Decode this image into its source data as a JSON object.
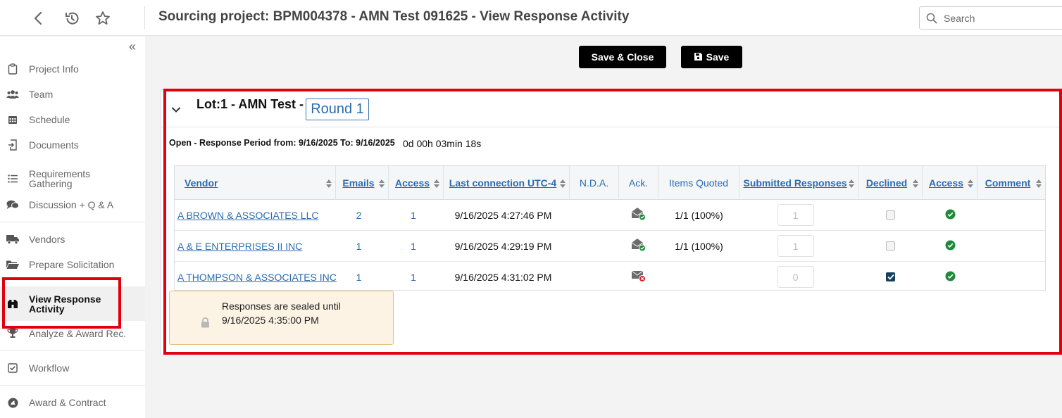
{
  "header": {
    "title": "Sourcing project: BPM004378 - AMN Test 091625 - View Response Activity",
    "search_placeholder": "Search"
  },
  "sidebar": {
    "items": [
      {
        "label": "Project Info",
        "icon": "clipboard-icon"
      },
      {
        "label": "Team",
        "icon": "team-icon"
      },
      {
        "label": "Schedule",
        "icon": "calendar-icon"
      },
      {
        "label": "Documents",
        "icon": "document-icon"
      },
      {
        "label": "Requirements Gathering",
        "icon": "list-icon"
      },
      {
        "label": "Discussion + Q & A",
        "icon": "chat-icon"
      },
      {
        "label": "Vendors",
        "icon": "truck-icon"
      },
      {
        "label": "Prepare Solicitation",
        "icon": "folder-icon"
      },
      {
        "label": "View Response Activity",
        "icon": "binoculars-icon",
        "active": true
      },
      {
        "label": "Analyze & Award Rec.",
        "icon": "trophy-icon"
      },
      {
        "label": "Workflow",
        "icon": "checkbox-icon"
      },
      {
        "label": "Award & Contract",
        "icon": "award-icon"
      }
    ]
  },
  "toolbar": {
    "save_close_label": "Save & Close",
    "save_label": "Save"
  },
  "lot": {
    "title": "Lot:1 - AMN Test -",
    "round": "Round 1",
    "period": "Open - Response Period from: 9/16/2025 To: 9/16/2025",
    "countdown": "0d 00h 03min 18s"
  },
  "table": {
    "columns": [
      "Vendor",
      "Emails",
      "Access",
      "Last connection UTC-4",
      "N.D.A.",
      "Ack.",
      "Items Quoted",
      "Submitted Responses",
      "Declined",
      "Access",
      "Comment"
    ],
    "rows": [
      {
        "vendor": "A BROWN & ASSOCIATES LLC",
        "emails": "2",
        "access": "1",
        "last_connection": "9/16/2025 4:27:46 PM",
        "nda": "",
        "ack": "acknowledged-icon",
        "items_quoted": "1/1 (100%)",
        "submitted": "1",
        "declined": false,
        "access_status": "check-icon",
        "comment": ""
      },
      {
        "vendor": "A & E ENTERPRISES II INC",
        "emails": "1",
        "access": "1",
        "last_connection": "9/16/2025 4:29:19 PM",
        "nda": "",
        "ack": "acknowledged-icon",
        "items_quoted": "1/1 (100%)",
        "submitted": "1",
        "declined": false,
        "access_status": "check-icon",
        "comment": ""
      },
      {
        "vendor": "A THOMPSON & ASSOCIATES INC",
        "emails": "1",
        "access": "1",
        "last_connection": "9/16/2025 4:31:02 PM",
        "nda": "",
        "ack": "declined-mail-icon",
        "items_quoted": "",
        "submitted": "0",
        "declined": true,
        "access_status": "check-icon",
        "comment": ""
      }
    ]
  },
  "sealed": {
    "text": "Responses are sealed until 9/16/2025 4:35:00 PM"
  },
  "colors": {
    "link": "#2a6cb0",
    "highlight": "#e00010",
    "success": "#1f8a3c",
    "error": "#d9202a"
  }
}
